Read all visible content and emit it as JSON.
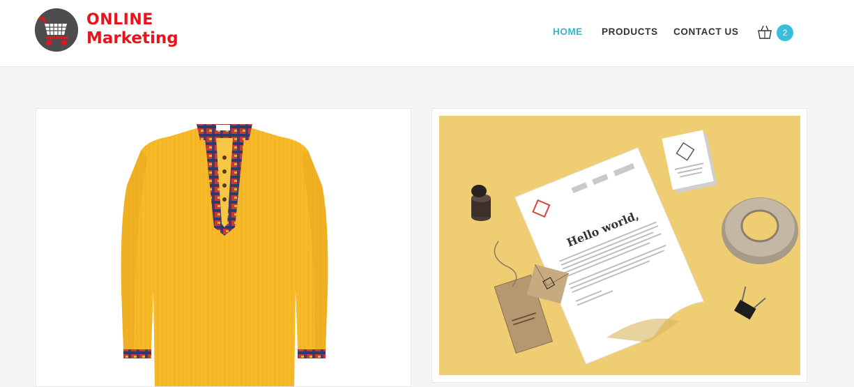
{
  "brand": {
    "line1": "ONLINE",
    "line2": "Marketing"
  },
  "nav": {
    "items": [
      {
        "label": "HOME",
        "active": true
      },
      {
        "label": "PRODUCTS",
        "active": false
      },
      {
        "label": "CONTACT US",
        "active": false
      }
    ]
  },
  "cart": {
    "icon": "shopping-bag-icon",
    "count": "2"
  },
  "colors": {
    "accent": "#37bfd9",
    "brand_red": "#e8141c",
    "page_bg": "#f5f5f5",
    "shirt_yellow": "#f6b928",
    "mockup_bg": "#efcd73"
  },
  "products": [
    {
      "image": "yellow-panjabi-shirt"
    },
    {
      "image": "stationery-mockup",
      "letter_heading": "Hello world,"
    }
  ]
}
